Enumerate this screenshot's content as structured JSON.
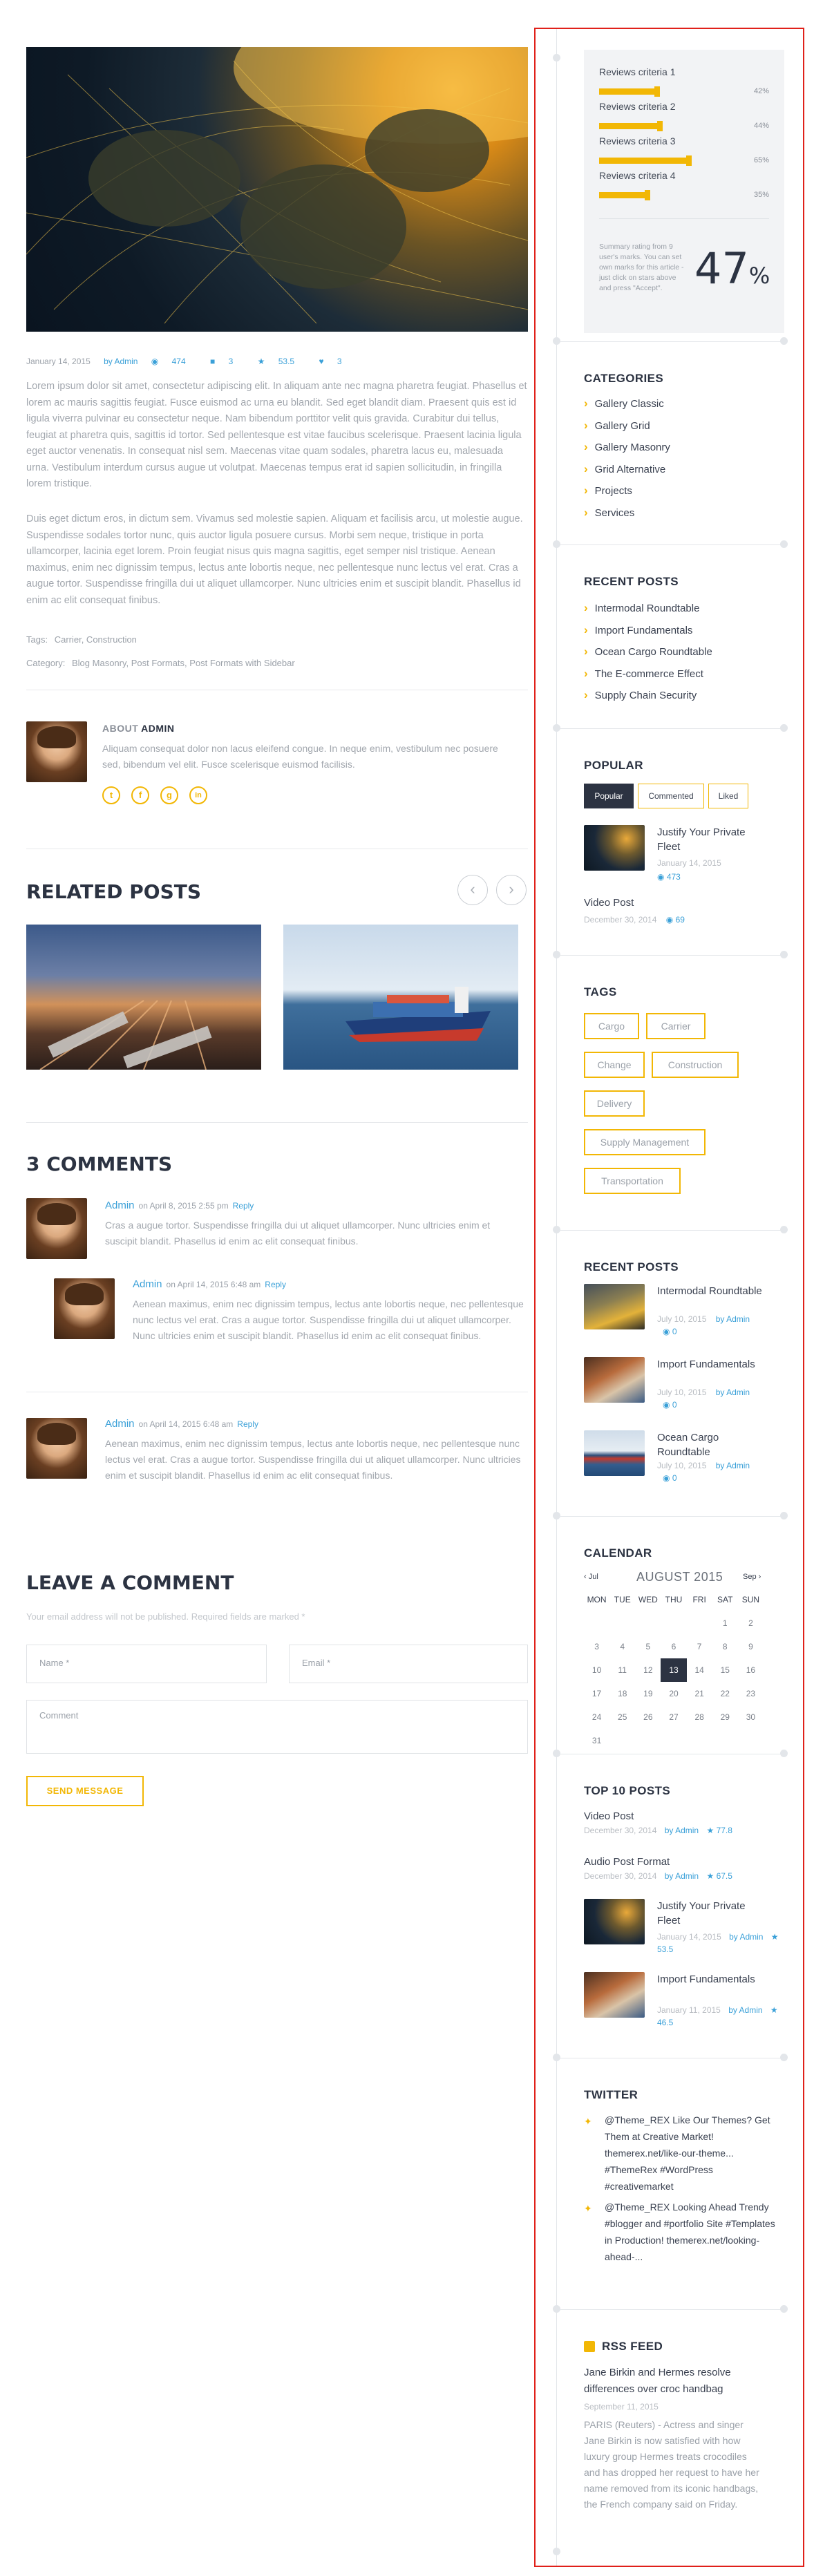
{
  "post": {
    "meta": {
      "date": "January 14, 2015",
      "by": "by Admin",
      "views": "474",
      "comments": "3",
      "rating": "53.5",
      "likes": "3"
    },
    "para1": "Lorem ipsum dolor sit amet, consectetur adipiscing elit. In aliquam ante nec magna pharetra feugiat. Phasellus et lorem ac mauris sagittis feugiat. Fusce euismod ac urna eu blandit. Sed eget blandit diam. Praesent quis est id ligula viverra pulvinar eu consectetur neque. Nam bibendum porttitor velit quis gravida. Curabitur dui tellus, feugiat at pharetra quis, sagittis id tortor. Sed pellentesque est vitae faucibus scelerisque. Praesent lacinia ligula eget auctor venenatis. In consequat nisl sem. Maecenas vitae quam sodales, pharetra lacus eu, malesuada urna. Vestibulum interdum cursus augue ut volutpat. Maecenas tempus erat id sapien sollicitudin, in fringilla lorem tristique.",
    "para2": "Duis eget dictum eros, in dictum sem. Vivamus sed molestie sapien. Aliquam et facilisis arcu, ut molestie augue. Suspendisse sodales tortor nunc, quis auctor ligula posuere cursus. Morbi sem neque, tristique in porta ullamcorper, lacinia eget lorem. Proin feugiat nisus quis magna sagittis, eget semper nisl tristique. Aenean maximus, enim nec dignissim tempus, lectus ante lobortis neque, nec pellentesque nunc lectus vel erat. Cras a augue tortor. Suspendisse fringilla dui ut aliquet ullamcorper. Nunc ultricies enim et suscipit blandit. Phasellus id enim ac elit consequat finibus.",
    "tags_label": "Tags:",
    "tags": "Carrier,  Construction",
    "category_label": "Category:",
    "categories": "Blog Masonry,  Post Formats,  Post Formats with Sidebar"
  },
  "about": {
    "heading_prefix": "ABOUT",
    "heading_name": "ADMIN",
    "text": "Aliquam consequat dolor non lacus eleifend congue. In neque enim, vestibulum nec posuere sed, bibendum vel elit. Fusce scelerisque euismod facilisis.",
    "social": [
      "t",
      "f",
      "g",
      "in"
    ]
  },
  "related": {
    "title": "RELATED POSTS",
    "prev": "‹",
    "next": "›"
  },
  "comments": {
    "title": "3 COMMENTS",
    "items": [
      {
        "author": "Admin",
        "date": "on April 8, 2015 2:55 pm",
        "reply": "Reply",
        "text": "Cras a augue tortor. Suspendisse fringilla dui ut aliquet ullamcorper. Nunc ultricies enim et suscipit blandit. Phasellus id enim ac elit consequat finibus."
      },
      {
        "author": "Admin",
        "date": "on April 14, 2015 6:48 am",
        "reply": "Reply",
        "text": "Aenean maximus, enim nec dignissim tempus, lectus ante lobortis neque, nec pellentesque nunc lectus vel erat. Cras a augue tortor. Suspendisse fringilla dui ut aliquet ullamcorper. Nunc ultricies enim et suscipit blandit. Phasellus id enim ac elit consequat finibus."
      },
      {
        "author": "Admin",
        "date": "on April 14, 2015 6:48 am",
        "reply": "Reply",
        "text": "Aenean maximus, enim nec dignissim tempus, lectus ante lobortis neque, nec pellentesque nunc lectus vel erat. Cras a augue tortor. Suspendisse fringilla dui ut aliquet ullamcorper. Nunc ultricies enim et suscipit blandit. Phasellus id enim ac elit consequat finibus."
      }
    ]
  },
  "leave": {
    "title": "LEAVE A COMMENT",
    "note": "Your email address will not be published. Required fields are marked *",
    "name_placeholder": "Name *",
    "email_placeholder": "Email *",
    "comment_placeholder": "Comment",
    "send": "SEND MESSAGE"
  },
  "sidebar": {
    "reviews": {
      "criteria": [
        {
          "label": "Reviews criteria 1",
          "pct": "42%",
          "value": 42
        },
        {
          "label": "Reviews criteria 2",
          "pct": "44%",
          "value": 44
        },
        {
          "label": "Reviews criteria 3",
          "pct": "65%",
          "value": 65
        },
        {
          "label": "Reviews criteria 4",
          "pct": "35%",
          "value": 35
        }
      ],
      "summary": "Summary rating from 9 user's marks. You can set own marks for this article - just click on stars above and press \"Accept\".",
      "score": "47",
      "score_unit": "%"
    },
    "categories": {
      "title": "CATEGORIES",
      "items": [
        "Gallery Classic",
        "Gallery Grid",
        "Gallery Masonry",
        "Grid Alternative",
        "Projects",
        "Services"
      ]
    },
    "recent": {
      "title": "RECENT POSTS",
      "items": [
        "Intermodal Roundtable",
        "Import Fundamentals",
        "Ocean Cargo Roundtable",
        "The E-commerce Effect",
        "Supply Chain Security"
      ]
    },
    "popular": {
      "title": "POPULAR",
      "tabs": [
        "Popular",
        "Commented",
        "Liked"
      ],
      "post1_title": "Justify Your Private Fleet",
      "post1_date": "January 14, 2015",
      "post1_views": "473",
      "post2_title": "Video Post",
      "post2_date": "December 30, 2014",
      "post2_views": "69"
    },
    "tags": {
      "title": "TAGS",
      "items": [
        "Cargo",
        "Carrier",
        "Change",
        "Construction",
        "Delivery",
        "Supply Management",
        "Transportation"
      ]
    },
    "recent2": {
      "title": "RECENT POSTS",
      "items": [
        {
          "title": "Intermodal Roundtable",
          "date": "July 10, 2015",
          "by": "by Admin",
          "views": "0"
        },
        {
          "title": "Import Fundamentals",
          "date": "July 10, 2015",
          "by": "by Admin",
          "views": "0"
        },
        {
          "title": "Ocean Cargo Roundtable",
          "date": "July 10, 2015",
          "by": "by Admin",
          "views": "0"
        }
      ]
    },
    "calendar": {
      "title": "CALENDAR",
      "prev": "‹ Jul",
      "month": "AUGUST 2015",
      "next": "Sep ›",
      "days": [
        "MON",
        "TUE",
        "WED",
        "THU",
        "FRI",
        "SAT",
        "SUN"
      ],
      "weeks": [
        [
          "",
          "",
          "",
          "",
          "",
          "1",
          "2"
        ],
        [
          "3",
          "4",
          "5",
          "6",
          "7",
          "8",
          "9"
        ],
        [
          "10",
          "11",
          "12",
          "13",
          "14",
          "15",
          "16"
        ],
        [
          "17",
          "18",
          "19",
          "20",
          "21",
          "22",
          "23"
        ],
        [
          "24",
          "25",
          "26",
          "27",
          "28",
          "29",
          "30"
        ],
        [
          "31",
          "",
          "",
          "",
          "",
          "",
          ""
        ]
      ],
      "today": "13"
    },
    "top10": {
      "title": "TOP 10 POSTS",
      "items": [
        {
          "title": "Video Post",
          "date": "December 30, 2014",
          "by": "by Admin",
          "rating": "77.8"
        },
        {
          "title": "Audio Post Format",
          "date": "December 30, 2014",
          "by": "by Admin",
          "rating": "67.5"
        },
        {
          "title": "Justify Your Private Fleet",
          "date": "January 14, 2015",
          "by": "by Admin",
          "rating": "53.5"
        },
        {
          "title": "Import Fundamentals",
          "date": "January 11, 2015",
          "by": "by Admin",
          "rating": "46.5"
        }
      ]
    },
    "twitter": {
      "title": "TWITTER",
      "tweets": [
        "@Theme_REX Like Our Themes? Get Them at Creative Market! themerex.net/like-our-theme... #ThemeRex #WordPress #creativemarket",
        "@Theme_REX Looking Ahead Trendy #blogger and #portfolio Site #Templates in Production! themerex.net/looking-ahead-..."
      ]
    },
    "rss": {
      "title": "RSS FEED",
      "headline": "Jane Birkin and Hermes resolve differences over croc handbag",
      "date": "September 11, 2015",
      "body": "PARIS (Reuters) - Actress and singer Jane Birkin is now satisfied with how luxury group Hermes treats crocodiles and has dropped her request to have her name removed from its iconic handbags, the French company said on Friday."
    }
  }
}
